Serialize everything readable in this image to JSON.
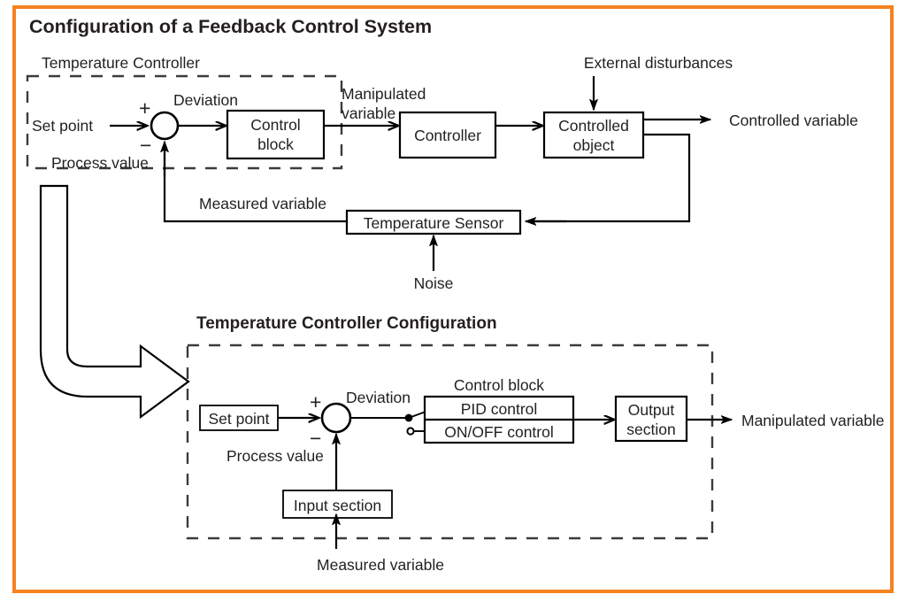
{
  "page": {
    "title": "Configuration of a Feedback Control System",
    "frame_color": "#f5821f",
    "text_color": "#231f20",
    "background": "#ffffff"
  },
  "top_diagram": {
    "group_label": "Temperature Controller",
    "inputs": {
      "set_point": "Set point",
      "process_value": "Process value"
    },
    "signs": {
      "plus": "+",
      "minus": "−"
    },
    "signals": {
      "deviation": "Deviation",
      "manipulated_variable": "Manipulated\nvariable",
      "manipulated_variable_line1": "Manipulated",
      "manipulated_variable_line2": "variable",
      "controlled_variable": "Controlled variable",
      "external_disturbances": "External disturbances",
      "measured_variable": "Measured variable",
      "noise": "Noise"
    },
    "blocks": [
      {
        "id": "control-block",
        "line1": "Control",
        "line2": "block"
      },
      {
        "id": "controller",
        "line1": "Controller",
        "line2": ""
      },
      {
        "id": "controlled-object",
        "line1": "Controlled",
        "line2": "object"
      },
      {
        "id": "temperature-sensor",
        "line1": "Temperature Sensor",
        "line2": ""
      }
    ]
  },
  "bottom_diagram": {
    "heading": "Temperature Controller Configuration",
    "signs": {
      "plus": "+",
      "minus": "−"
    },
    "labels": {
      "set_point": "Set point",
      "process_value": "Process value",
      "deviation": "Deviation",
      "control_block": "Control block",
      "pid_control": "PID control",
      "onoff_control": "ON/OFF control",
      "output_section_line1": "Output",
      "output_section_line2": "section",
      "input_section": "Input section",
      "measured_variable": "Measured variable",
      "manipulated_variable": "Manipulated variable"
    },
    "switch": {
      "selected": "PID control",
      "alternate": "ON/OFF control"
    }
  },
  "big_arrow": {
    "name": "expansion-arrow",
    "from": "Temperature Controller",
    "to": "Temperature Controller Configuration"
  }
}
